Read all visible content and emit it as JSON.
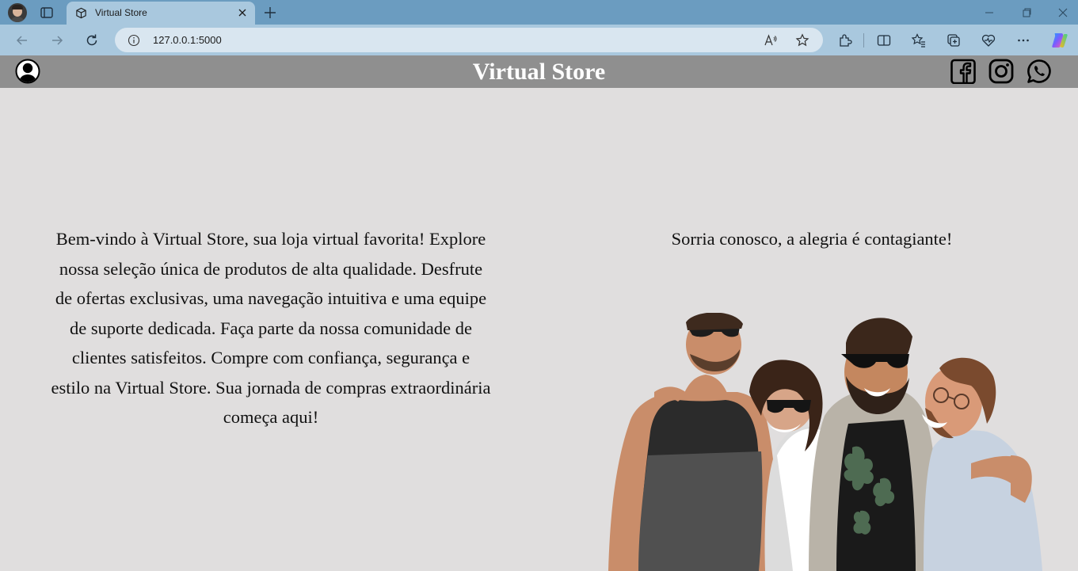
{
  "browser": {
    "tab_title": "Virtual Store",
    "url": "127.0.0.1:5000"
  },
  "header": {
    "title": "Virtual Store"
  },
  "main": {
    "welcome_text": "Bem-vindo à Virtual Store, sua loja virtual favorita! Explore nossa seleção única de produtos de alta qualidade. Desfrute de ofertas exclusivas, uma navegação intuitiva e uma equipe de suporte dedicada. Faça parte da nossa comunidade de clientes satisfeitos. Compre com confiança, segurança e estilo na Virtual Store. Sua jornada de compras extraordinária começa aqui!",
    "tagline": "Sorria conosco, a alegria é contagiante!"
  },
  "icons": {
    "user": "user-icon",
    "social": [
      "facebook-icon",
      "instagram-icon",
      "whatsapp-icon"
    ]
  },
  "colors": {
    "header_bg": "#8f8f8f",
    "page_bg": "#e0dede",
    "title_color": "#ffffff"
  }
}
